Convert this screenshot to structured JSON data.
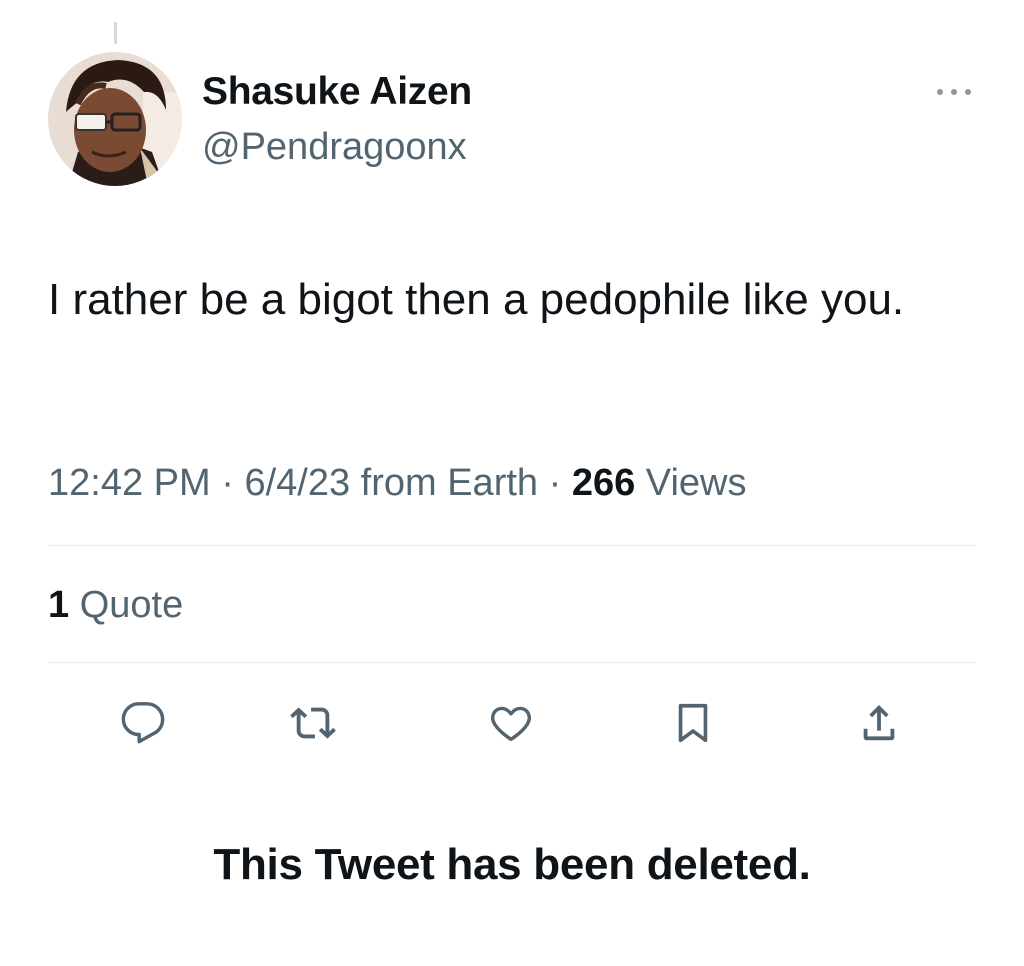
{
  "author": {
    "display_name": "Shasuke Aizen",
    "handle": "@Pendragoonx",
    "avatar_icon": "profile-avatar"
  },
  "tweet": {
    "text": "I rather be a bigot then a pedophile like you.",
    "time": "12:42 PM",
    "date": "6/4/23",
    "source": "from Earth",
    "views_count": "266",
    "views_label": "Views",
    "separator": "·"
  },
  "stats": {
    "quote_count": "1",
    "quote_label": "Quote"
  },
  "actions": [
    {
      "name": "reply",
      "icon": "reply-icon"
    },
    {
      "name": "retweet",
      "icon": "retweet-icon"
    },
    {
      "name": "like",
      "icon": "heart-icon"
    },
    {
      "name": "bookmark",
      "icon": "bookmark-icon"
    },
    {
      "name": "share",
      "icon": "share-icon"
    }
  ],
  "notice": "This Tweet has been deleted.",
  "colors": {
    "text_primary": "#0f1419",
    "text_secondary": "#536471",
    "divider": "#e7ecf0"
  }
}
